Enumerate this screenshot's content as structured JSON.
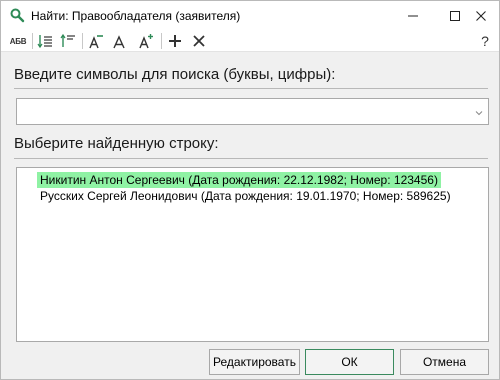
{
  "window": {
    "title": "Найти:  Правообладателя (заявителя)"
  },
  "toolbar": {
    "abv_label": "АБВ"
  },
  "search": {
    "label": "Введите символы для поиска (буквы, цифры):",
    "value": ""
  },
  "results": {
    "label": "Выберите найденную строку:",
    "rows": [
      {
        "text": "Никитин Антон Сергеевич (Дата рождения: 22.12.1982; Номер: 123456)",
        "selected": true
      },
      {
        "text": "Русских Сергей Леонидович (Дата рождения: 19.01.1970; Номер: 589625)",
        "selected": false
      }
    ]
  },
  "buttons": {
    "edit": "Редактировать",
    "ok": "ОК",
    "cancel": "Отмена"
  },
  "colors": {
    "selection": "#8ff2a4",
    "accent": "#3a8a5e"
  }
}
